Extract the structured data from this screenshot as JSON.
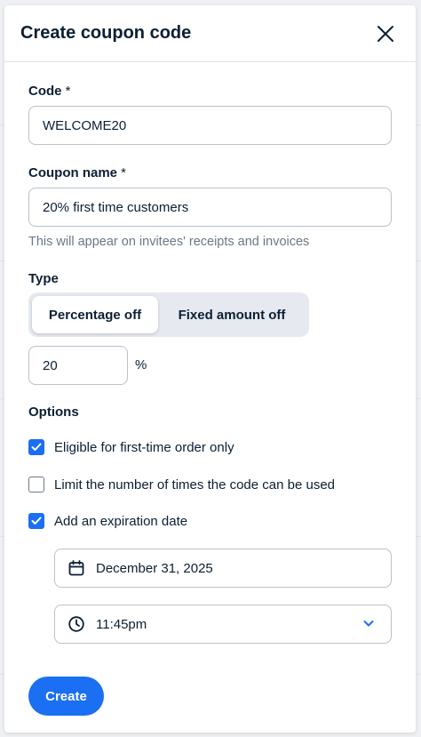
{
  "dialog": {
    "title": "Create coupon code"
  },
  "code": {
    "label": "Code",
    "required_mark": "*",
    "value": "WELCOME20"
  },
  "coupon_name": {
    "label": "Coupon name",
    "required_mark": "*",
    "value": "20% first time customers",
    "helper": "This will appear on invitees' receipts and invoices"
  },
  "type": {
    "label": "Type",
    "options": [
      "Percentage off",
      "Fixed amount off"
    ],
    "selected": "Percentage off",
    "amount": "20",
    "unit": "%"
  },
  "options": {
    "label": "Options",
    "items": [
      {
        "label": "Eligible for first-time order only",
        "checked": true
      },
      {
        "label": "Limit the number of times the code can be used",
        "checked": false
      },
      {
        "label": "Add an expiration date",
        "checked": true
      }
    ]
  },
  "expiration": {
    "date": "December 31, 2025",
    "time": "11:45pm",
    "date_icon": "calendar-icon",
    "time_icon": "clock-icon"
  },
  "actions": {
    "create_label": "Create"
  },
  "colors": {
    "accent": "#1a6ff2",
    "text": "#0b1f33",
    "helper": "#6a7887",
    "border": "#b9c1cb"
  }
}
